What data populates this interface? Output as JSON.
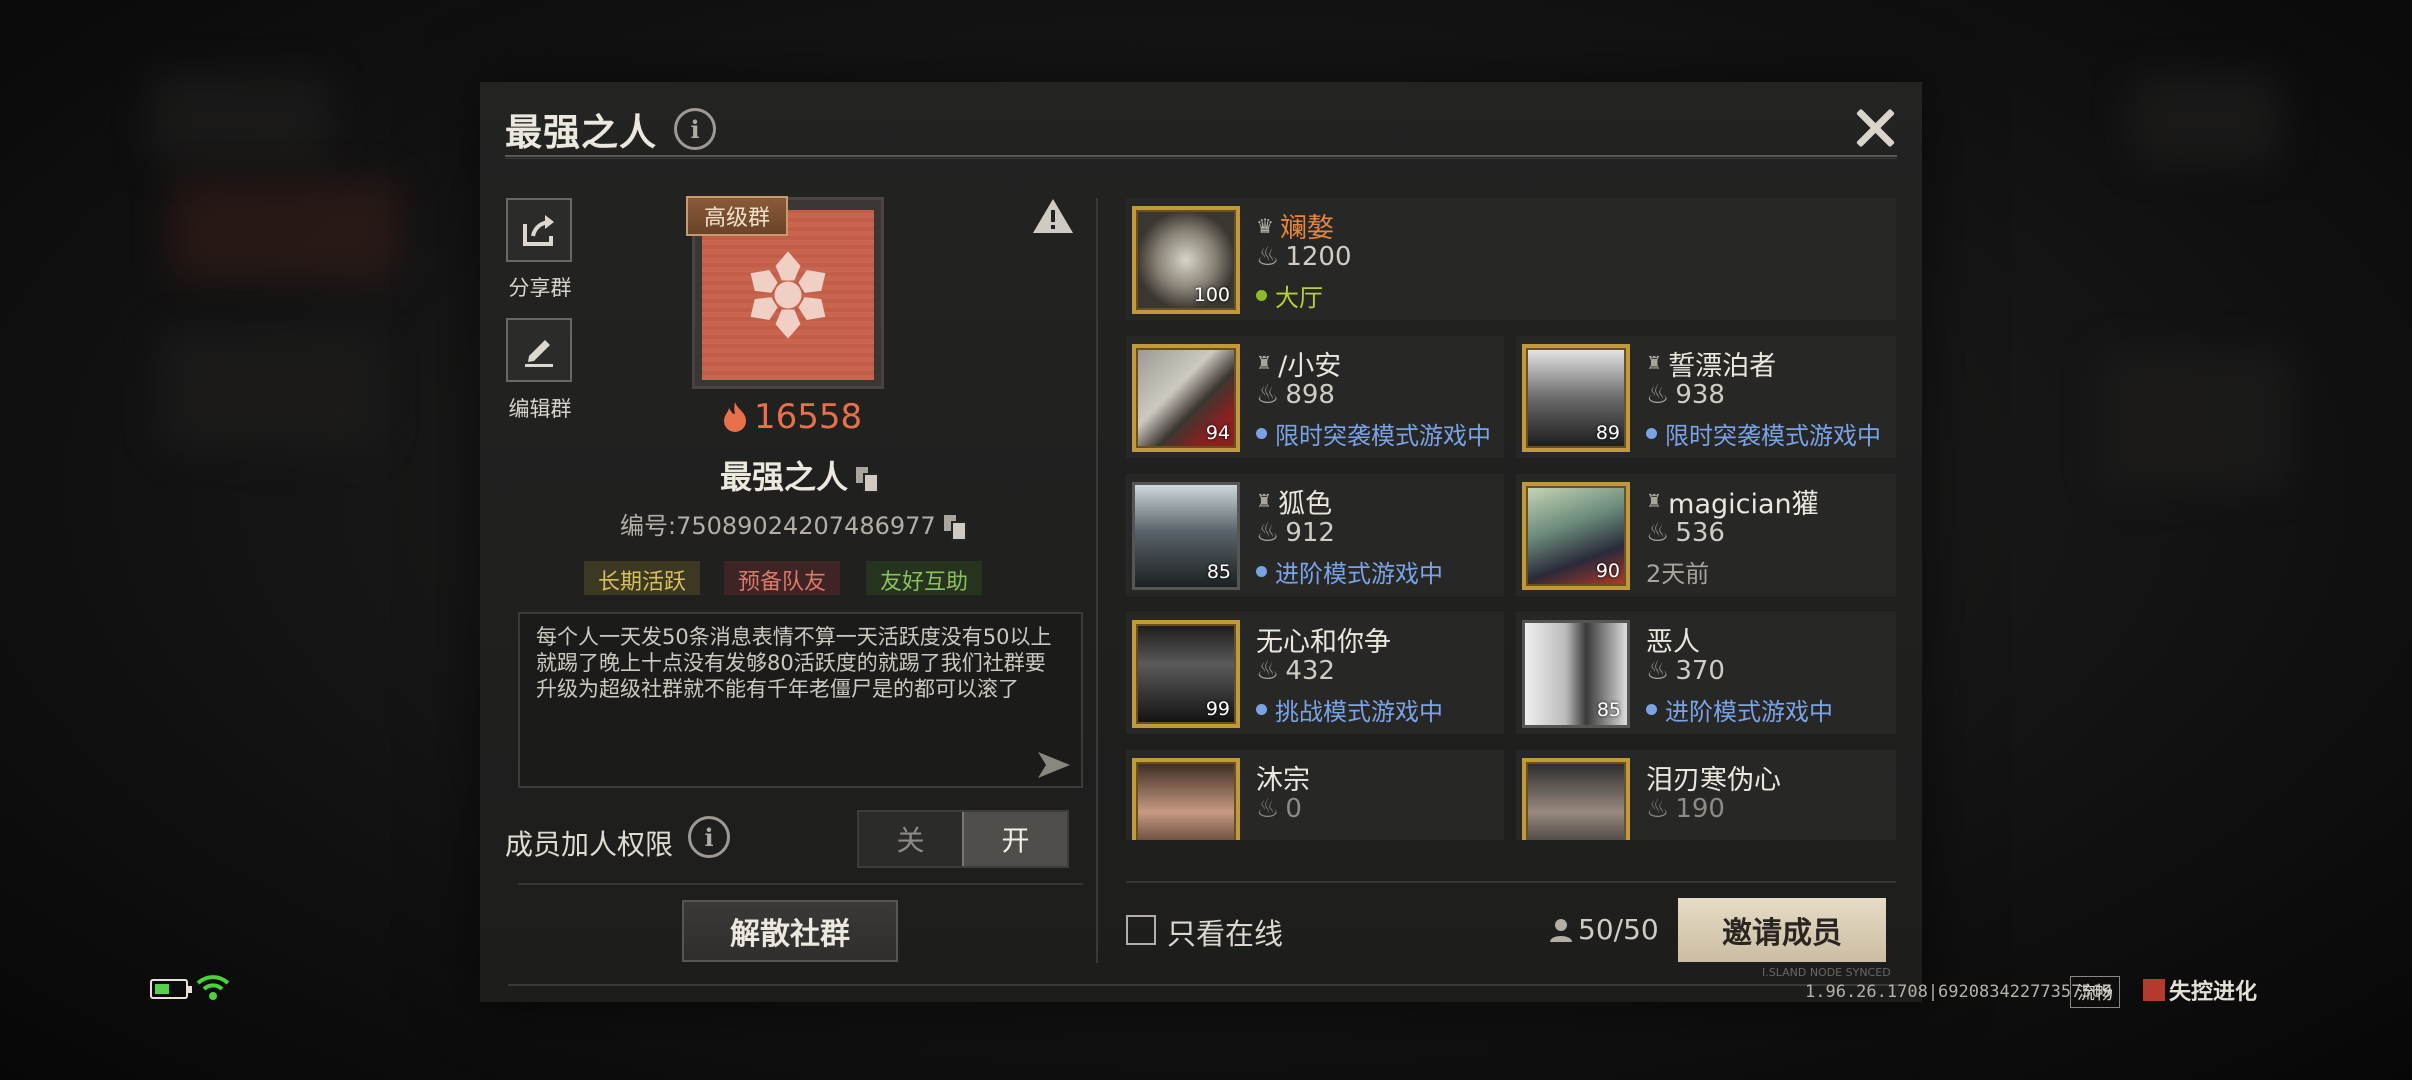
{
  "dialog": {
    "title": "最强之人",
    "share_label": "分享群",
    "edit_label": "编辑群",
    "group_level_tag": "高级群",
    "score": "16558",
    "group_name": "最强之人",
    "group_id": "编号:75089024207486977",
    "tags": [
      "长期活跃",
      "预备队友",
      "友好互助"
    ],
    "description": "每个人一天发50条消息表情不算一天活跃度没有50以上就踢了晚上十点没有发够80活跃度的就踢了我们社群要升级为超级社群就不能有千年老僵尸是的都可以滚了",
    "permission_label": "成员加人权限",
    "toggle_off": "关",
    "toggle_on": "开",
    "dissolve_button": "解散社群"
  },
  "members": [
    {
      "name": "斓嫯",
      "score": "1200",
      "level": "100",
      "status": "大厅",
      "status_type": "green",
      "role": "leader"
    },
    {
      "name": "/小安",
      "score": "898",
      "level": "94",
      "status": "限时突袭模式游戏中",
      "status_type": "blue"
    },
    {
      "name": "誓漂泊者",
      "score": "938",
      "level": "89",
      "status": "限时突袭模式游戏中",
      "status_type": "blue"
    },
    {
      "name": "狐色",
      "score": "912",
      "level": "85",
      "status": "进阶模式游戏中",
      "status_type": "blue"
    },
    {
      "name": "magician獾",
      "score": "536",
      "level": "90",
      "status": "2天前",
      "status_type": "grey"
    },
    {
      "name": "无心和你争",
      "score": "432",
      "level": "99",
      "status": "挑战模式游戏中",
      "status_type": "blue"
    },
    {
      "name": "恶人",
      "score": "370",
      "level": "85",
      "status": "进阶模式游戏中",
      "status_type": "blue"
    },
    {
      "name": "沐宗",
      "score": "0",
      "level": "",
      "status": "",
      "status_type": "grey"
    },
    {
      "name": "泪刃寒伪心",
      "score": "190",
      "level": "",
      "status": "",
      "status_type": "grey"
    }
  ],
  "footer": {
    "online_only_label": "只看在线",
    "member_count": "50/50",
    "invite_button": "邀请成员",
    "version": "1.96.26.1708|69208342277357569",
    "sync_label": "I.SLAND NODE SYNCED",
    "network_label": "流畅",
    "logo_text": "失控进化"
  },
  "colors": {
    "accent_orange": "#e8704a",
    "status_blue": "#7aa3e6",
    "status_green": "#8cbc2a",
    "invite_bg": "#e8dcc6"
  }
}
